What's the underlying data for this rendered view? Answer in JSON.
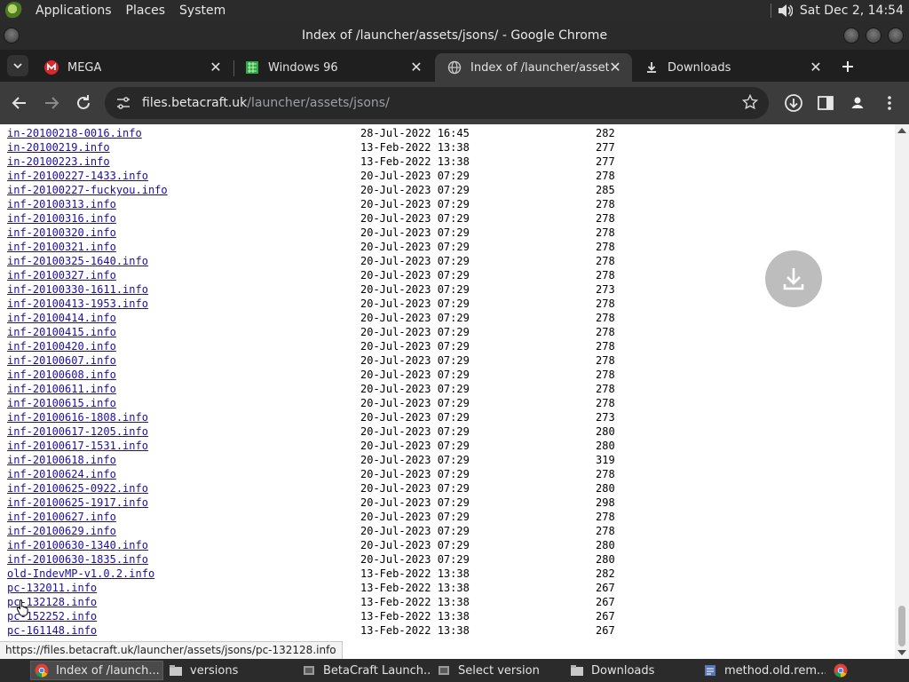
{
  "panel": {
    "menus": [
      "Applications",
      "Places",
      "System"
    ],
    "clock": "Sat Dec  2, 14:54"
  },
  "window": {
    "title": "Index of /launcher/assets/jsons/ - Google Chrome"
  },
  "tabs": [
    {
      "title": "MEGA"
    },
    {
      "title": "Windows 96"
    },
    {
      "title": "Index of /launcher/assets/js"
    },
    {
      "title": "Downloads"
    }
  ],
  "toolbar": {
    "url_host": "files.betacraft.uk",
    "url_path": "/launcher/assets/jsons/"
  },
  "colors": {
    "link": "#1a0dab",
    "mega": "#d9272e",
    "toolbar": "#3c3c3c"
  },
  "listing": [
    {
      "name": "in-20100218-0016.info",
      "date": "28-Jul-2022 16:45",
      "size": "282"
    },
    {
      "name": "in-20100219.info",
      "date": "13-Feb-2022 13:38",
      "size": "277"
    },
    {
      "name": "in-20100223.info",
      "date": "13-Feb-2022 13:38",
      "size": "277"
    },
    {
      "name": "inf-20100227-1433.info",
      "date": "20-Jul-2023 07:29",
      "size": "278"
    },
    {
      "name": "inf-20100227-fuckyou.info",
      "date": "20-Jul-2023 07:29",
      "size": "285"
    },
    {
      "name": "inf-20100313.info",
      "date": "20-Jul-2023 07:29",
      "size": "278"
    },
    {
      "name": "inf-20100316.info",
      "date": "20-Jul-2023 07:29",
      "size": "278"
    },
    {
      "name": "inf-20100320.info",
      "date": "20-Jul-2023 07:29",
      "size": "278"
    },
    {
      "name": "inf-20100321.info",
      "date": "20-Jul-2023 07:29",
      "size": "278"
    },
    {
      "name": "inf-20100325-1640.info",
      "date": "20-Jul-2023 07:29",
      "size": "278"
    },
    {
      "name": "inf-20100327.info",
      "date": "20-Jul-2023 07:29",
      "size": "278"
    },
    {
      "name": "inf-20100330-1611.info",
      "date": "20-Jul-2023 07:29",
      "size": "273"
    },
    {
      "name": "inf-20100413-1953.info",
      "date": "20-Jul-2023 07:29",
      "size": "278"
    },
    {
      "name": "inf-20100414.info",
      "date": "20-Jul-2023 07:29",
      "size": "278"
    },
    {
      "name": "inf-20100415.info",
      "date": "20-Jul-2023 07:29",
      "size": "278"
    },
    {
      "name": "inf-20100420.info",
      "date": "20-Jul-2023 07:29",
      "size": "278"
    },
    {
      "name": "inf-20100607.info",
      "date": "20-Jul-2023 07:29",
      "size": "278"
    },
    {
      "name": "inf-20100608.info",
      "date": "20-Jul-2023 07:29",
      "size": "278"
    },
    {
      "name": "inf-20100611.info",
      "date": "20-Jul-2023 07:29",
      "size": "278"
    },
    {
      "name": "inf-20100615.info",
      "date": "20-Jul-2023 07:29",
      "size": "278"
    },
    {
      "name": "inf-20100616-1808.info",
      "date": "20-Jul-2023 07:29",
      "size": "273"
    },
    {
      "name": "inf-20100617-1205.info",
      "date": "20-Jul-2023 07:29",
      "size": "280"
    },
    {
      "name": "inf-20100617-1531.info",
      "date": "20-Jul-2023 07:29",
      "size": "280"
    },
    {
      "name": "inf-20100618.info",
      "date": "20-Jul-2023 07:29",
      "size": "319"
    },
    {
      "name": "inf-20100624.info",
      "date": "20-Jul-2023 07:29",
      "size": "278"
    },
    {
      "name": "inf-20100625-0922.info",
      "date": "20-Jul-2023 07:29",
      "size": "280"
    },
    {
      "name": "inf-20100625-1917.info",
      "date": "20-Jul-2023 07:29",
      "size": "298"
    },
    {
      "name": "inf-20100627.info",
      "date": "20-Jul-2023 07:29",
      "size": "278"
    },
    {
      "name": "inf-20100629.info",
      "date": "20-Jul-2023 07:29",
      "size": "278"
    },
    {
      "name": "inf-20100630-1340.info",
      "date": "20-Jul-2023 07:29",
      "size": "280"
    },
    {
      "name": "inf-20100630-1835.info",
      "date": "20-Jul-2023 07:29",
      "size": "280"
    },
    {
      "name": "old-IndevMP-v1.0.2.info",
      "date": "13-Feb-2022 13:38",
      "size": "282"
    },
    {
      "name": "pc-132011.info",
      "date": "13-Feb-2022 13:38",
      "size": "267"
    },
    {
      "name": "pc-132128.info",
      "date": "13-Feb-2022 13:38",
      "size": "267"
    },
    {
      "name": "pc-152252.info",
      "date": "13-Feb-2022 13:38",
      "size": "267"
    },
    {
      "name": "pc-161148.info",
      "date": "13-Feb-2022 13:38",
      "size": "267"
    }
  ],
  "status_url": "https://files.betacraft.uk/launcher/assets/jsons/pc-132128.info",
  "taskbar": [
    {
      "label": "Index of /launch...",
      "icon": "chrome-icon"
    },
    {
      "label": "versions",
      "icon": "folder-icon"
    },
    {
      "label": "BetaCraft Launch...",
      "icon": "java-icon"
    },
    {
      "label": "Select version",
      "icon": "java-icon"
    },
    {
      "label": "Downloads",
      "icon": "folder-icon"
    },
    {
      "label": "method.old.rem...",
      "icon": "editor-icon"
    }
  ]
}
